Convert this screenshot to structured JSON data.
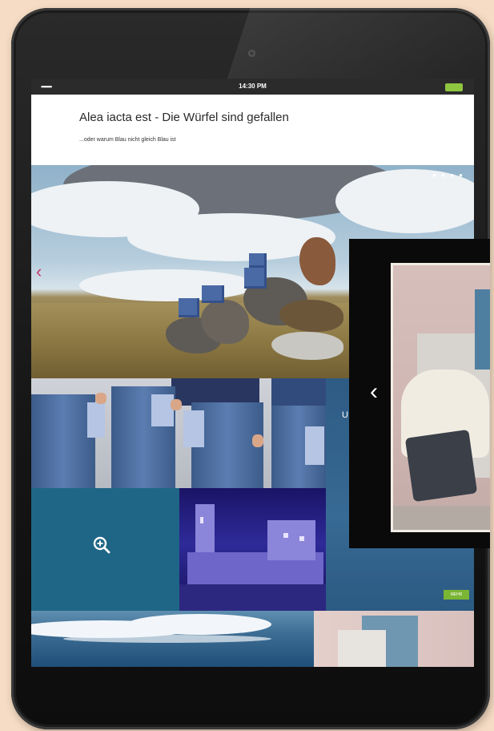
{
  "status_bar": {
    "signal": "▪▪▪▪▪▪",
    "time": "14:30 PM"
  },
  "article": {
    "title": "Alea iacta est - Die Würfel sind gefallen",
    "subtitle": "...oder warum Blau nicht gleich Blau ist"
  },
  "gallery": {
    "dots": "● ● ● ●",
    "prev_glyph": "‹",
    "side_text": "U",
    "badge": "MEHR"
  },
  "overlay": {
    "prev_glyph": "‹"
  },
  "icons": {
    "zoom": "zoom-in-icon",
    "prev": "chevron-left-icon",
    "battery": "battery-icon"
  },
  "colors": {
    "accent": "#c23a6a",
    "tile_blue": "#1f6686",
    "badge_green": "#7ab534"
  }
}
